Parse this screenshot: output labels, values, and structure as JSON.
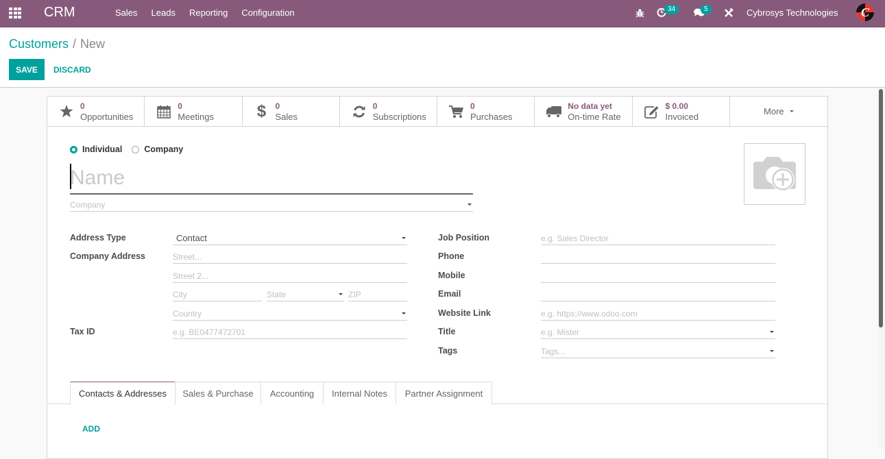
{
  "navbar": {
    "app_name": "CRM",
    "menu": [
      "Sales",
      "Leads",
      "Reporting",
      "Configuration"
    ],
    "activity_count": "34",
    "messages_count": "5",
    "company": "Cybrosys Technologies",
    "icons": {
      "apps": "apps-grid-icon",
      "debug": "bug-icon",
      "activity": "clock-icon",
      "messages": "comments-icon",
      "tools": "tools-icon"
    }
  },
  "breadcrumb": {
    "parent": "Customers",
    "separator": "/",
    "current": "New"
  },
  "actions": {
    "save": "SAVE",
    "discard": "DISCARD"
  },
  "stat_buttons": [
    {
      "icon": "star-icon",
      "value": "0",
      "label": "Opportunities"
    },
    {
      "icon": "calendar-icon",
      "value": "0",
      "label": "Meetings"
    },
    {
      "icon": "dollar-icon",
      "value": "0",
      "label": "Sales"
    },
    {
      "icon": "refresh-icon",
      "value": "0",
      "label": "Subscriptions"
    },
    {
      "icon": "cart-icon",
      "value": "0",
      "label": "Purchases"
    },
    {
      "icon": "truck-icon",
      "value": "No data yet",
      "label": "On-time Rate"
    },
    {
      "icon": "edit-icon",
      "value": "$ 0.00",
      "label": "Invoiced"
    }
  ],
  "more_label": "More",
  "partner_type": {
    "options": [
      "Individual",
      "Company"
    ],
    "selected": "Individual"
  },
  "form": {
    "name_placeholder": "Name",
    "company_placeholder": "Company",
    "left": {
      "address_type_label": "Address Type",
      "address_type_value": "Contact",
      "company_address_label": "Company Address",
      "street_placeholder": "Street...",
      "street2_placeholder": "Street 2...",
      "city_placeholder": "City",
      "state_placeholder": "State",
      "zip_placeholder": "ZIP",
      "country_placeholder": "Country",
      "tax_id_label": "Tax ID",
      "tax_id_placeholder": "e.g. BE0477472701"
    },
    "right": {
      "job_position_label": "Job Position",
      "job_position_placeholder": "e.g. Sales Director",
      "phone_label": "Phone",
      "mobile_label": "Mobile",
      "email_label": "Email",
      "website_label": "Website Link",
      "website_placeholder": "e.g. https://www.odoo.com",
      "title_label": "Title",
      "title_placeholder": "e.g. Mister",
      "tags_label": "Tags",
      "tags_placeholder": "Tags..."
    }
  },
  "tabs": [
    "Contacts & Addresses",
    "Sales & Purchase",
    "Accounting",
    "Internal Notes",
    "Partner Assignment"
  ],
  "active_tab": "Contacts & Addresses",
  "add_label": "ADD",
  "colors": {
    "brand": "#875a7b",
    "accent": "#00a09d"
  }
}
